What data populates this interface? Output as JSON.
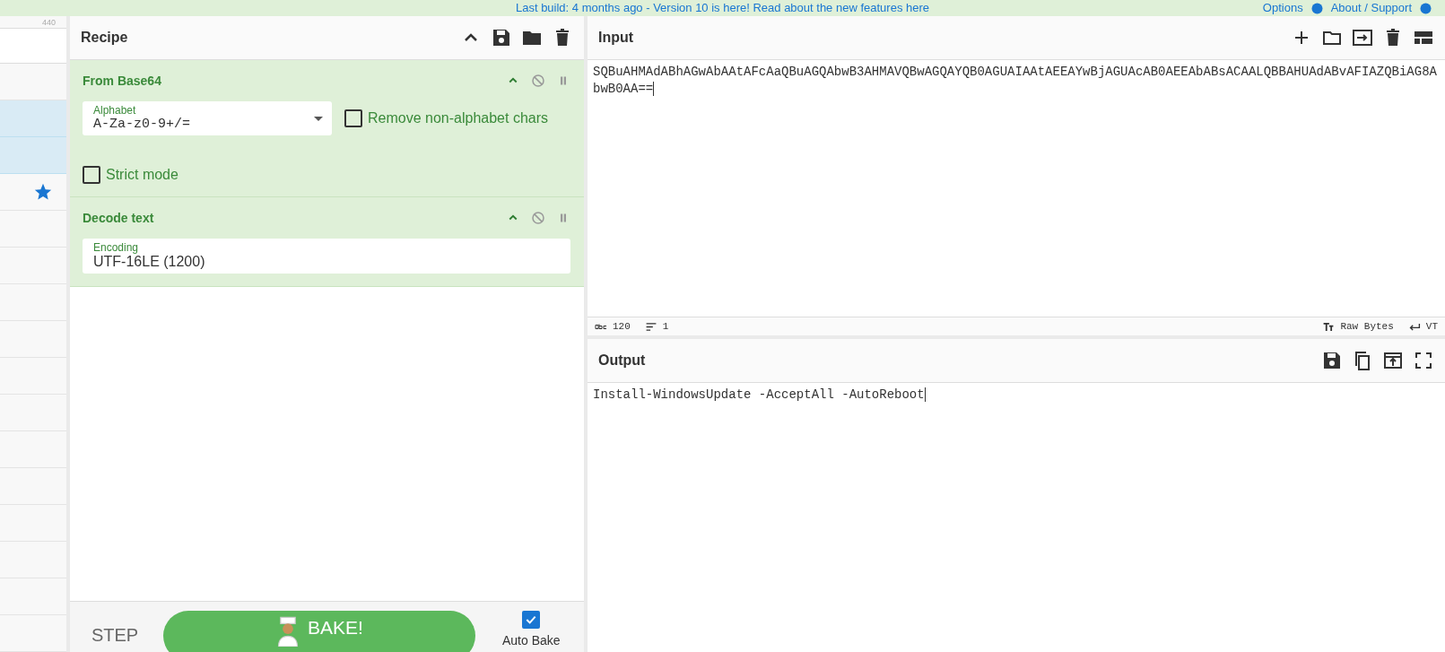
{
  "banner": {
    "message": "Last build: 4 months ago - Version 10 is here! Read about the new features here",
    "options": "Options",
    "support": "About / Support"
  },
  "operations": {
    "count": "440",
    "rows": [
      {
        "selected": false,
        "starred": false
      },
      {
        "selected": true,
        "starred": false
      },
      {
        "selected": true,
        "starred": false
      },
      {
        "selected": false,
        "starred": true
      },
      {
        "selected": false,
        "starred": false
      },
      {
        "selected": false,
        "starred": false
      },
      {
        "selected": false,
        "starred": false
      },
      {
        "selected": false,
        "starred": false
      },
      {
        "selected": false,
        "starred": false
      },
      {
        "selected": false,
        "starred": false
      },
      {
        "selected": false,
        "starred": false
      },
      {
        "selected": false,
        "starred": false
      },
      {
        "selected": false,
        "starred": false
      },
      {
        "selected": false,
        "starred": false
      },
      {
        "selected": false,
        "starred": false
      },
      {
        "selected": false,
        "starred": false
      }
    ]
  },
  "recipe": {
    "title": "Recipe",
    "operations": [
      {
        "name": "From Base64",
        "args": [
          {
            "kind": "select",
            "label": "Alphabet",
            "value": "A-Za-z0-9+/=",
            "mono": true
          },
          {
            "kind": "checkbox",
            "label": "Remove non-alphabet chars",
            "checked": false
          },
          {
            "kind": "checkbox",
            "label": "Strict mode",
            "checked": false
          }
        ]
      },
      {
        "name": "Decode text",
        "args": [
          {
            "kind": "text",
            "label": "Encoding",
            "value": "UTF-16LE (1200)",
            "mono": false
          }
        ]
      }
    ],
    "step": "STEP",
    "bake": "BAKE!",
    "auto_bake": {
      "label": "Auto Bake",
      "checked": true
    }
  },
  "input": {
    "title": "Input",
    "value": "SQBuAHMAdABhAGwAbAAtAFcAaQBuAGQAbwB3AHMAVQBwAGQAYQB0AGUAIAAtAEEAYwBjAGUAcAB0AEEAbABsACAALQBBAHUAdABvAFIAZQBiAG8AbwB0AA==",
    "status": {
      "length": "120",
      "lines": "1",
      "mode": "Raw Bytes",
      "eol": "VT"
    }
  },
  "output": {
    "title": "Output",
    "value": "Install-WindowsUpdate -AcceptAll -AutoReboot"
  }
}
